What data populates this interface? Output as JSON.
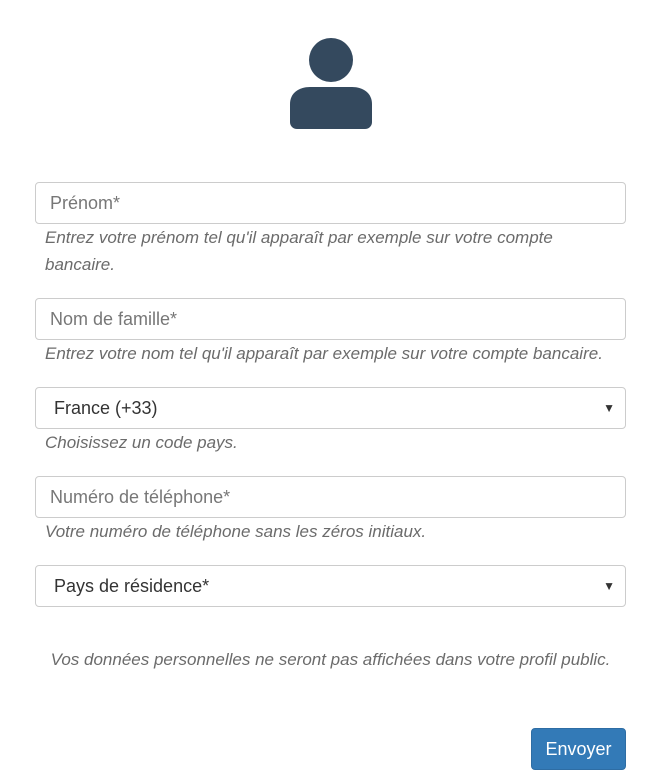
{
  "icons": {
    "avatar": "user-icon",
    "select_caret": "caret-down-icon"
  },
  "colors": {
    "avatar": "#34495e",
    "primary_button": "#337ab7",
    "border": "#cccccc"
  },
  "form": {
    "first_name": {
      "placeholder": "Prénom*",
      "help": "Entrez votre prénom tel qu'il apparaît par exemple sur votre compte bancaire."
    },
    "last_name": {
      "placeholder": "Nom de famille*",
      "help": "Entrez votre nom tel qu'il apparaît par exemple sur votre compte bancaire."
    },
    "country_code": {
      "selected": "France (+33)",
      "help": "Choisissez un code pays."
    },
    "phone": {
      "placeholder": "Numéro de téléphone*",
      "help": "Votre numéro de téléphone sans les zéros initiaux."
    },
    "residence": {
      "selected": "Pays de résidence*"
    },
    "notice": "Vos données personnelles ne seront pas affichées dans votre profil public.",
    "submit_label": "Envoyer"
  }
}
